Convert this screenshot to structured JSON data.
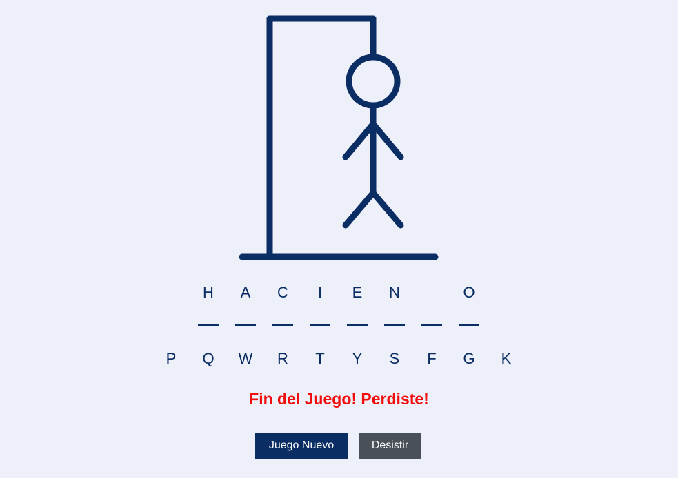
{
  "word_slots": [
    "H",
    "A",
    "C",
    "I",
    "E",
    "N",
    "",
    "O"
  ],
  "wrong_letters": [
    "P",
    "Q",
    "W",
    "R",
    "T",
    "Y",
    "S",
    "F",
    "G",
    "K"
  ],
  "status_message": "Fin del Juego! Perdiste!",
  "buttons": {
    "new_game": "Juego Nuevo",
    "quit": "Desistir"
  },
  "colors": {
    "background": "#eef0f9",
    "primary": "#0a2d63",
    "status": "#f20d0d",
    "secondary_button": "#4a5058"
  },
  "hangman_parts_visible": [
    "base",
    "pole",
    "beam",
    "rope",
    "head",
    "body",
    "left-arm",
    "right-arm",
    "left-leg",
    "right-leg"
  ]
}
